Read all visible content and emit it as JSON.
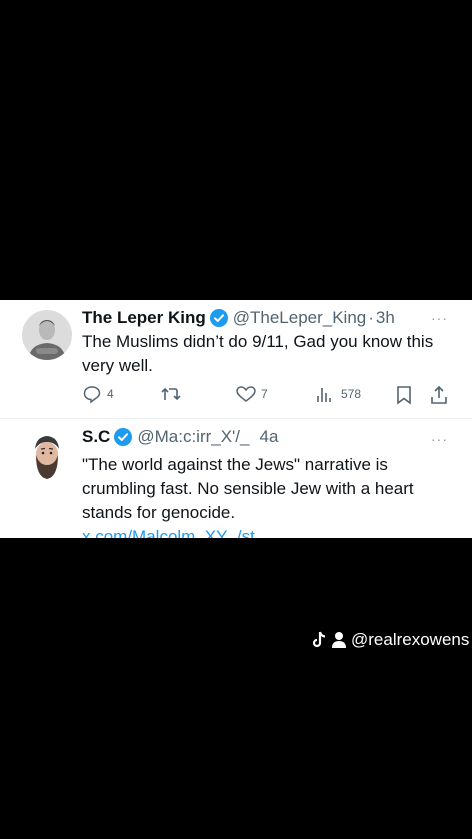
{
  "tweets": [
    {
      "display_name": "The Leper King",
      "handle": "@TheLeper_King",
      "separator": "·",
      "time": "3h",
      "text": "The Muslims didn’t do 9/11, Gad you know this very well.",
      "more_label": "···",
      "actions": {
        "replies": "4",
        "reposts": "",
        "likes": "7",
        "views": "578"
      },
      "avatar_icon": "man-avatar-icon"
    },
    {
      "display_name": "S.C",
      "handle": "@Ma:c:irr_X'/_",
      "separator": "",
      "time": "4a",
      "text": "\"The world against the Jews\" narrative is crumbling fast. No sensible Jew with a heart stands for genocide.",
      "link": "x.com/Malcolm_XY_/st",
      "more_label": "···",
      "avatar_icon": "bearded-man-avatar-icon"
    }
  ],
  "watermark": {
    "text": "@realrexowens",
    "icons": [
      "tiktok-icon",
      "user-icon"
    ]
  },
  "colors": {
    "accent": "#1d9bf0",
    "text": "#0f1419",
    "muted": "#536471",
    "background": "#000000"
  }
}
